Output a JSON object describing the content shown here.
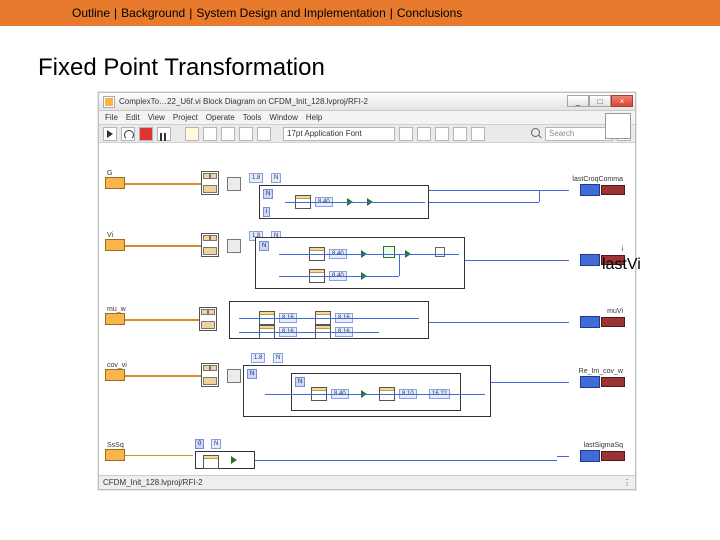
{
  "breadcrumb": {
    "items": [
      "Outline",
      "Background",
      "System Design and Implementation",
      "Conclusions"
    ],
    "sep": "|"
  },
  "slide_title": "Fixed Point Transformation",
  "window": {
    "title": "ComplexTo…22_U6f.vi Block Diagram on CFDM_Init_128.lvproj/RFI-2",
    "minimize": "_",
    "maximize": "□",
    "close": "×"
  },
  "menu": [
    "File",
    "Edit",
    "View",
    "Project",
    "Operate",
    "Tools",
    "Window",
    "Help"
  ],
  "toolbar": {
    "font_label": "17pt Application Font",
    "search_placeholder": "Search",
    "help": "?"
  },
  "statusbar": {
    "left": "CFDM_Init_128.lvproj/RFI-2",
    "right": "⋮"
  },
  "terminals": {
    "left": [
      "G",
      "Vi",
      "mu_w",
      "cov_vi",
      "SsSq"
    ],
    "right": [
      "lastCroqComma",
      "lastVi",
      "muVi",
      "Re_Im_cov_w",
      "lastSigmaSq"
    ]
  },
  "fxp": {
    "a": "1.8",
    "n": "N",
    "a2": "1.8",
    "n2": "N",
    "p1": "8.40",
    "p2": "8.40",
    "m1": "8.16",
    "m2": "8.16",
    "c1": "8.40",
    "c2": "8.40",
    "c3": "8.10",
    "c4": "16.22",
    "s1": "N"
  },
  "consts": {
    "idx0": "0"
  }
}
